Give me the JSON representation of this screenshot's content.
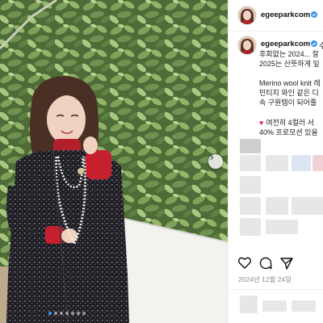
{
  "post": {
    "username": "egeeparkcom",
    "follow_label": "수",
    "caption_lines": [
      "후회없는 2024... 잘",
      "2025는 산뜻하게 잎",
      "Merino wool knit 레",
      "민티지 와인 같은 디",
      "속 구원템이 되어줄",
      "여전히 4컬러 서",
      "40% 프로모션 있을"
    ],
    "date": "2024년 12월 24일",
    "image_dots": 7,
    "active_dot": 0
  },
  "icons": {
    "verified": "verified-badge-icon",
    "heart": "heart-icon",
    "comment": "comment-icon",
    "share": "share-icon",
    "next": "chevron-right-icon",
    "red_heart": "red-heart-emoji"
  },
  "colors": {
    "verified": "#3897f0",
    "active_dot": "#3b97f0",
    "date": "#8e8e8e",
    "red_heart": "#e0245e"
  }
}
